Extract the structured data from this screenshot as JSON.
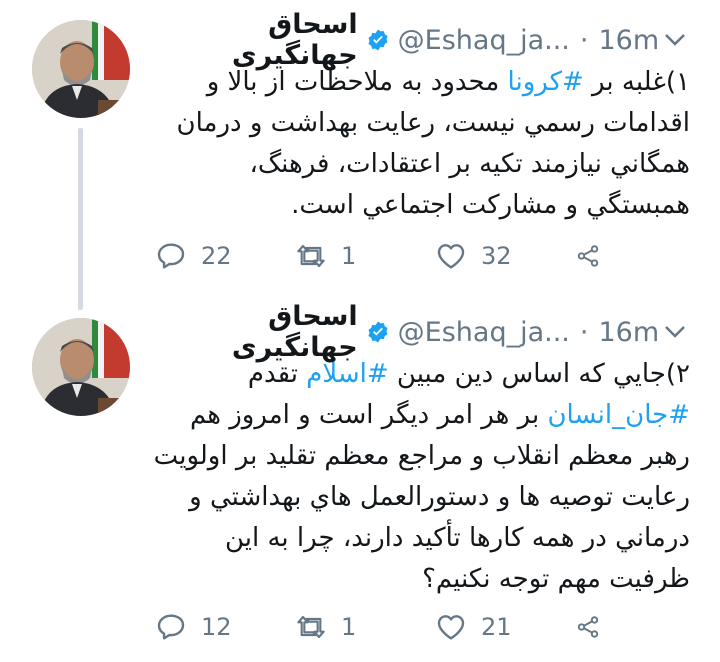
{
  "tweets": [
    {
      "author": {
        "name": "اسحاق جهانگیری",
        "handle": "@Eshaq_ja...",
        "verified": true
      },
      "time": "16m",
      "text_parts": [
        {
          "t": "۱)غلبه بر ",
          "tag": false
        },
        {
          "t": "#کرونا",
          "tag": true
        },
        {
          "t": " محدود به ملاحظات از بالا و اقدامات رسمي نيست، رعايت بهداشت و درمان همگاني نيازمند تكيه بر اعتقادات، فرهنگ، همبستگي و مشاركت اجتماعي است.",
          "tag": false
        }
      ],
      "actions": {
        "replies": "22",
        "retweets": "1",
        "likes": "32"
      }
    },
    {
      "author": {
        "name": "اسحاق جهانگیری",
        "handle": "@Eshaq_ja...",
        "verified": true
      },
      "time": "16m",
      "text_parts": [
        {
          "t": "۲)جايي كه اساس دين مبين ",
          "tag": false
        },
        {
          "t": "#اسلام",
          "tag": true
        },
        {
          "t": " تقدم ",
          "tag": false
        },
        {
          "t": "#جان_انسان",
          "tag": true
        },
        {
          "t": " بر هر امر ديگر است و امروز هم رهبر معظم انقلاب و مراجع معظم تقليد بر اولويت رعايت توصيه ها و دستورالعمل هاي بهداشتي و درماني در همه كارها تأكيد دارند، چرا به اين ظرفيت مهم توجه نكنيم؟",
          "tag": false
        }
      ],
      "actions": {
        "replies": "12",
        "retweets": "1",
        "likes": "21"
      }
    }
  ],
  "colors": {
    "hashtag": "#1da1f2",
    "muted": "#657786",
    "verified": "#1da1f2",
    "thread_line": "#d4dadf"
  },
  "icons": [
    "reply-icon",
    "retweet-icon",
    "like-icon",
    "share-icon",
    "verified-badge-icon",
    "chevron-down-icon"
  ]
}
